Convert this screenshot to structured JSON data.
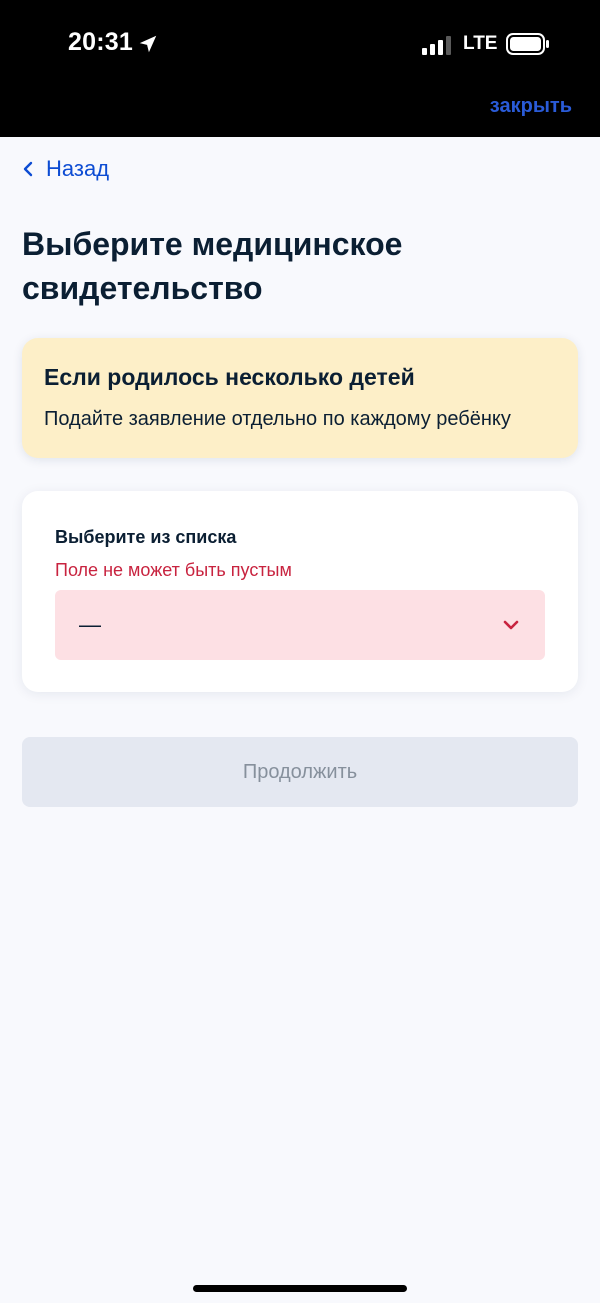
{
  "status_bar": {
    "time": "20:31",
    "network": "LTE"
  },
  "header": {
    "close_label": "закрыть"
  },
  "nav": {
    "back_label": "Назад"
  },
  "page": {
    "title": "Выберите медицинское свидетельство"
  },
  "info_card": {
    "title": "Если родилось несколько детей",
    "text": "Подайте заявление отдельно по каждому ребёнку"
  },
  "form": {
    "label": "Выберите из списка",
    "error": "Поле не может быть пустым",
    "select_value": "—"
  },
  "actions": {
    "continue_label": "Продолжить"
  },
  "icons": {
    "location": "location-arrow-icon",
    "signal": "signal-bars-icon",
    "battery": "battery-icon",
    "back": "chevron-left-icon",
    "dropdown": "chevron-down-icon"
  },
  "colors": {
    "accent_blue": "#0d4cd3",
    "error_red": "#c8233f",
    "warning_bg": "#fdefc8",
    "error_field_bg": "#fde0e4",
    "disabled_button_bg": "#e4e8f1",
    "page_bg": "#f8f9fd"
  }
}
